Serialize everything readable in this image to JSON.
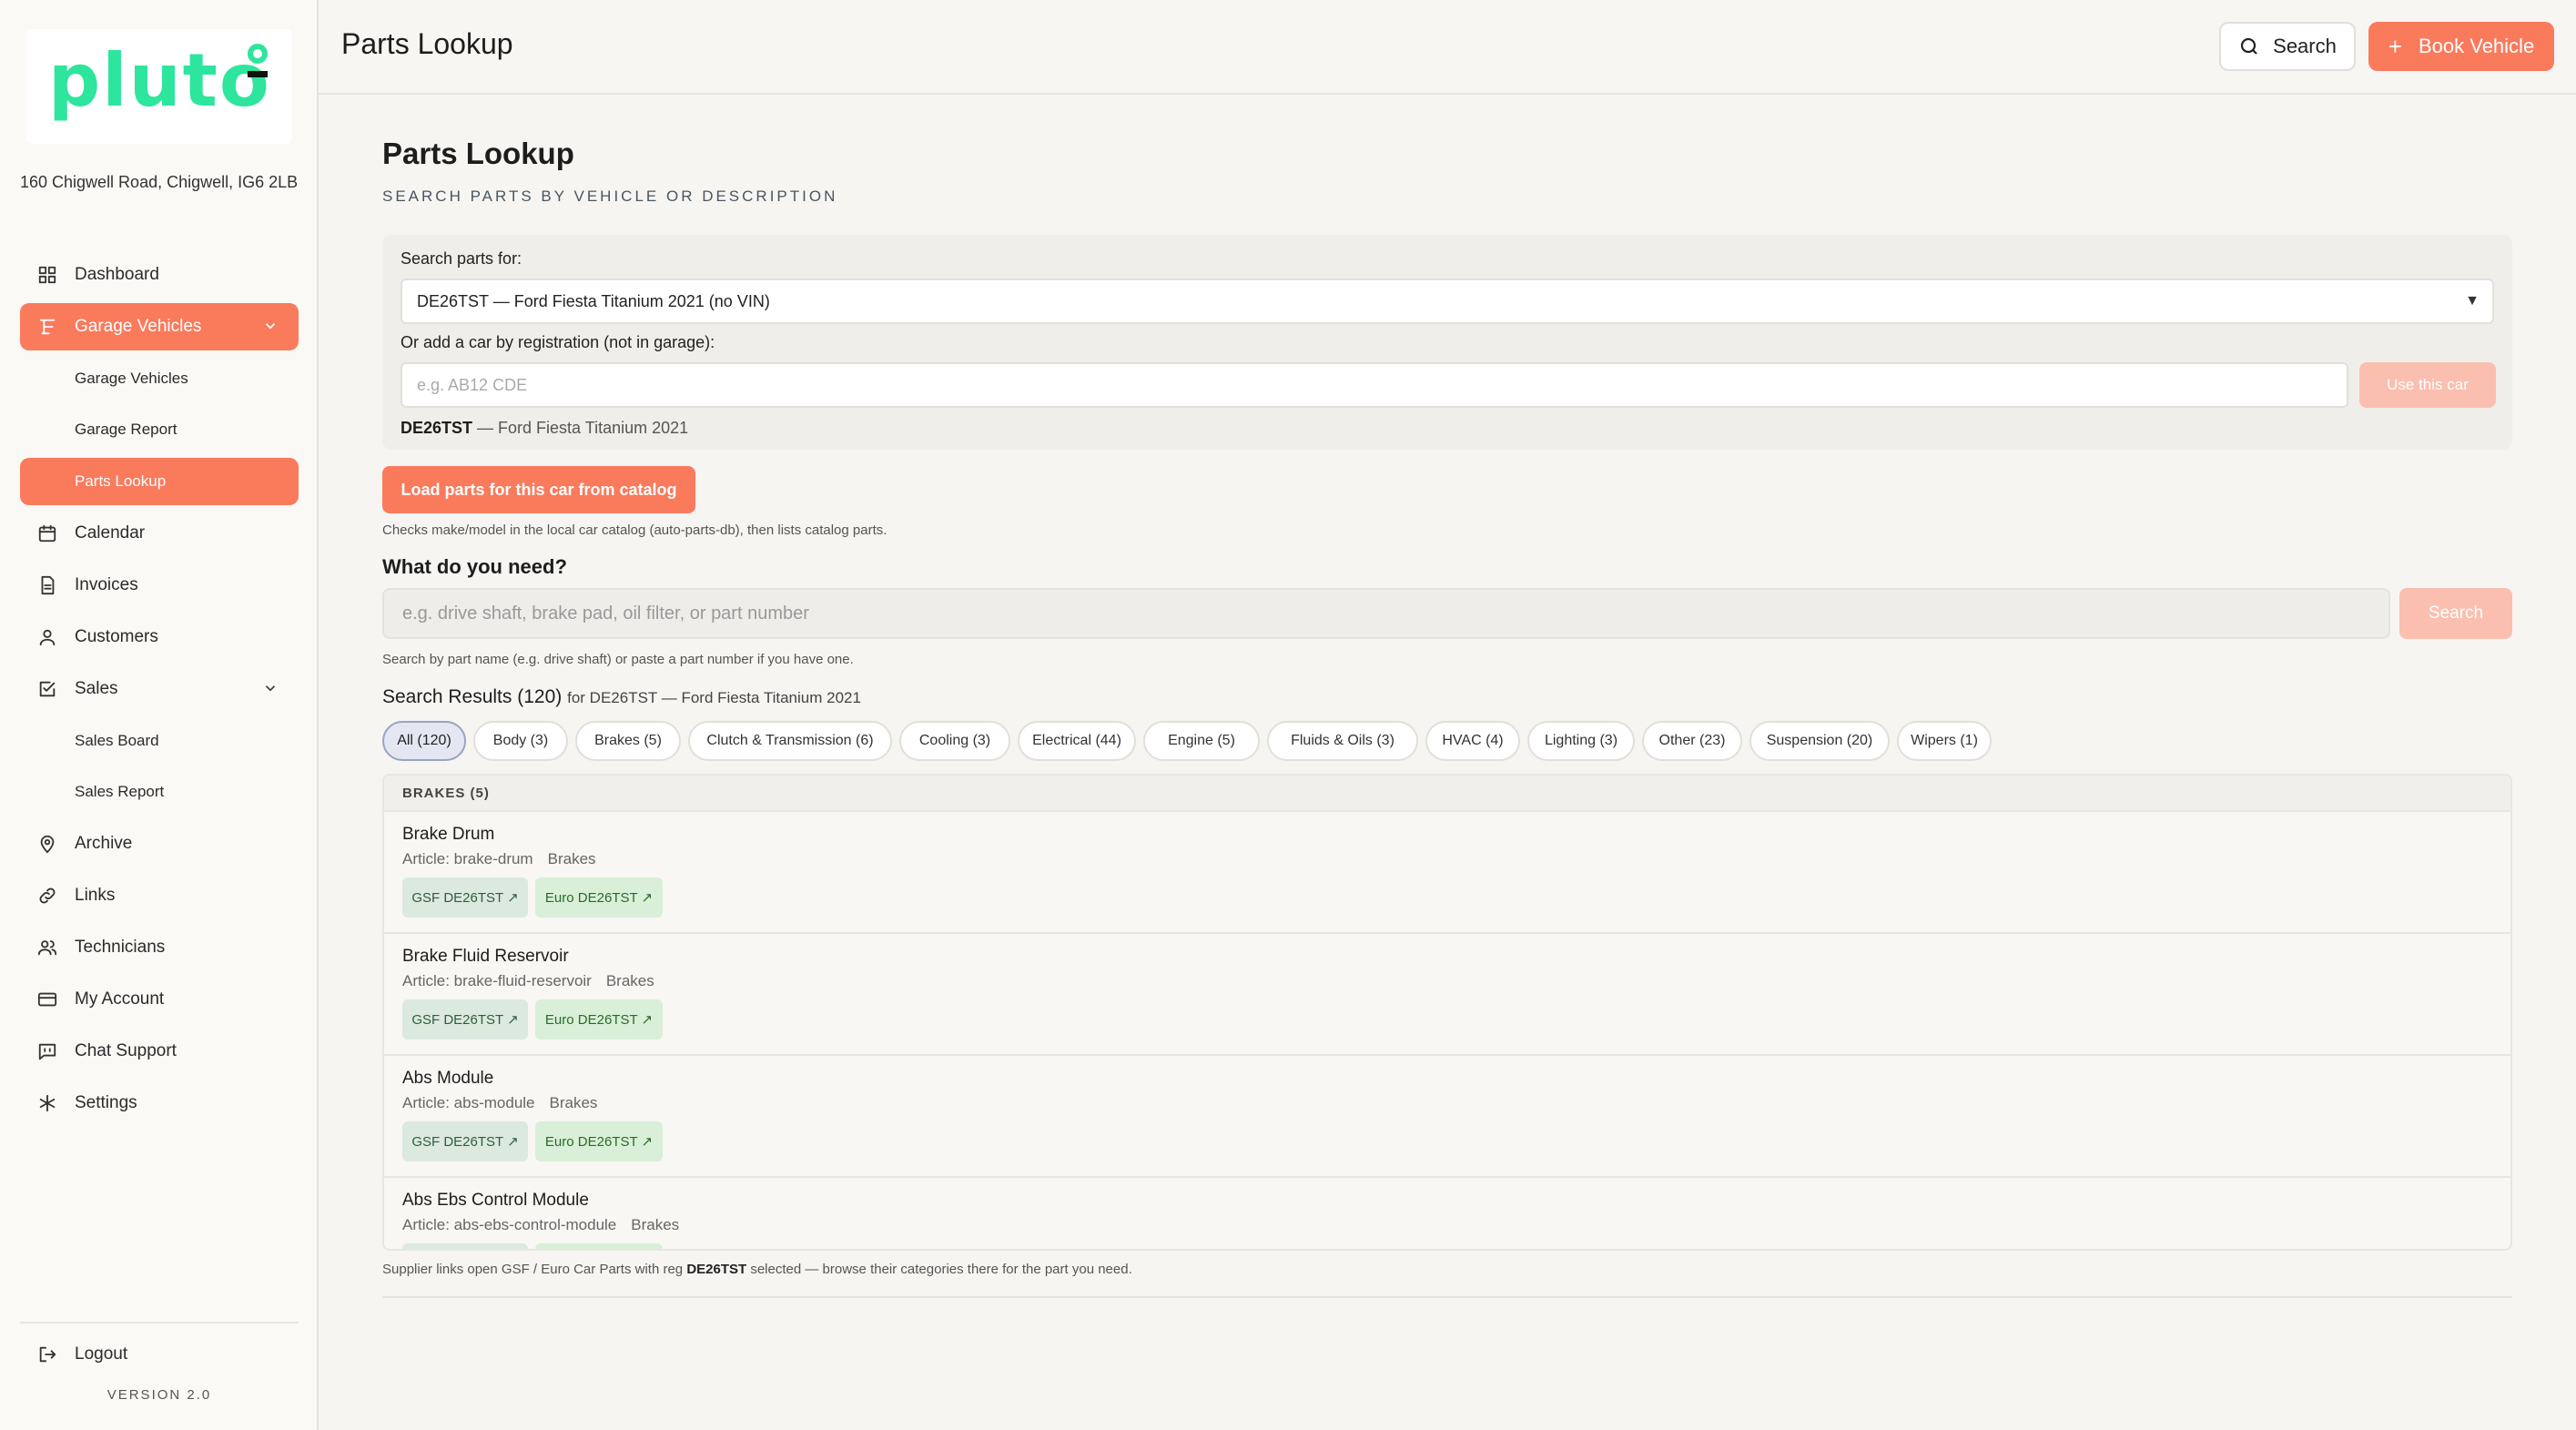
{
  "sidebar": {
    "logo": "pluto",
    "address": "160 Chigwell Road, Chigwell, IG6 2LB",
    "items": [
      {
        "label": "Dashboard"
      },
      {
        "label": "Garage Vehicles"
      },
      {
        "label": "Garage Vehicles"
      },
      {
        "label": "Garage Report"
      },
      {
        "label": "Parts Lookup"
      },
      {
        "label": "Calendar"
      },
      {
        "label": "Invoices"
      },
      {
        "label": "Customers"
      },
      {
        "label": "Sales"
      },
      {
        "label": "Sales Board"
      },
      {
        "label": "Sales Report"
      },
      {
        "label": "Archive"
      },
      {
        "label": "Links"
      },
      {
        "label": "Technicians"
      },
      {
        "label": "My Account"
      },
      {
        "label": "Chat Support"
      },
      {
        "label": "Settings"
      }
    ],
    "logout": "Logout",
    "version": "VERSION 2.0"
  },
  "header": {
    "title": "Parts Lookup",
    "search_label": "Search",
    "book_label": "Book Vehicle"
  },
  "main": {
    "title": "Parts Lookup",
    "subtitle": "SEARCH PARTS BY VEHICLE OR DESCRIPTION",
    "search_for_label": "Search parts for:",
    "selected_vehicle": "DE26TST — Ford Fiesta Titanium 2021 (no VIN)",
    "add_reg_label": "Or add a car by registration (not in garage):",
    "reg_placeholder": "e.g. AB12 CDE",
    "use_car_label": "Use this car",
    "current_reg": "DE26TST",
    "current_car": " — Ford Fiesta Titanium 2021",
    "load_label": "Load parts for this car from catalog",
    "load_hint": "Checks make/model in the local car catalog (auto-parts-db), then lists catalog parts.",
    "need_title": "What do you need?",
    "need_placeholder": "e.g. drive shaft, brake pad, oil filter, or part number",
    "search_button": "Search",
    "need_hint": "Search by part name (e.g. drive shaft) or paste a part number if you have one.",
    "results_title": "Search Results (120)",
    "results_for": "for DE26TST — Ford Fiesta Titanium 2021",
    "chips": [
      "All (120)",
      "Body (3)",
      "Brakes (5)",
      "Clutch & Transmission (6)",
      "Cooling (3)",
      "Electrical (44)",
      "Engine (5)",
      "Fluids & Oils (3)",
      "HVAC (4)",
      "Lighting (3)",
      "Other (23)",
      "Suspension (20)",
      "Wipers (1)"
    ],
    "group_header": "BRAKES (5)",
    "parts": [
      {
        "name": "Brake Drum",
        "article": "Article: brake-drum",
        "category": "Brakes",
        "gsf": "GSF DE26TST ↗",
        "euro": "Euro DE26TST ↗"
      },
      {
        "name": "Brake Fluid Reservoir",
        "article": "Article: brake-fluid-reservoir",
        "category": "Brakes",
        "gsf": "GSF DE26TST ↗",
        "euro": "Euro DE26TST ↗"
      },
      {
        "name": "Abs Module",
        "article": "Article: abs-module",
        "category": "Brakes",
        "gsf": "GSF DE26TST ↗",
        "euro": "Euro DE26TST ↗"
      },
      {
        "name": "Abs Ebs Control Module",
        "article": "Article: abs-ebs-control-module",
        "category": "Brakes",
        "gsf": "",
        "euro": ""
      }
    ],
    "footnote_pre": "Supplier links open GSF / Euro Car Parts with reg ",
    "footnote_reg": "DE26TST",
    "footnote_post": " selected — browse their categories there for the part you need."
  },
  "colors": {
    "accent": "#fa7a5c",
    "accent_disabled": "#fbbfb0",
    "logo": "#2ee59d"
  }
}
